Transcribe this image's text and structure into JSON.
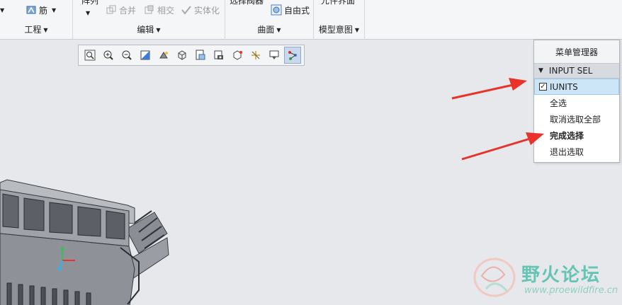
{
  "ribbon": {
    "groups": [
      {
        "label": "工程"
      },
      {
        "label": "编辑"
      },
      {
        "label": "曲面"
      },
      {
        "label": "模型意图"
      }
    ],
    "tools": {
      "rib": "筋",
      "merge": "合并",
      "intersect": "相交",
      "solidify": "实体化",
      "freeform": "自由式",
      "pattern_cut": "阵列",
      "select_cut": "选择阀器",
      "family_cut": "元件界面"
    }
  },
  "menu_manager": {
    "title": "菜单管理器",
    "section": "INPUT SEL",
    "items": [
      {
        "label": "IUNITS",
        "checked": true
      },
      {
        "label": "全选"
      },
      {
        "label": "取消选取全部"
      },
      {
        "label": "完成选择"
      },
      {
        "label": "退出选取"
      }
    ]
  },
  "watermark": {
    "title": "野火论坛",
    "url": "www.proewildfire.cn"
  },
  "colors": {
    "annotation_arrow": "#e8322a",
    "viewport_bg": "#e6e8ec",
    "highlight": "#cde6f7"
  }
}
